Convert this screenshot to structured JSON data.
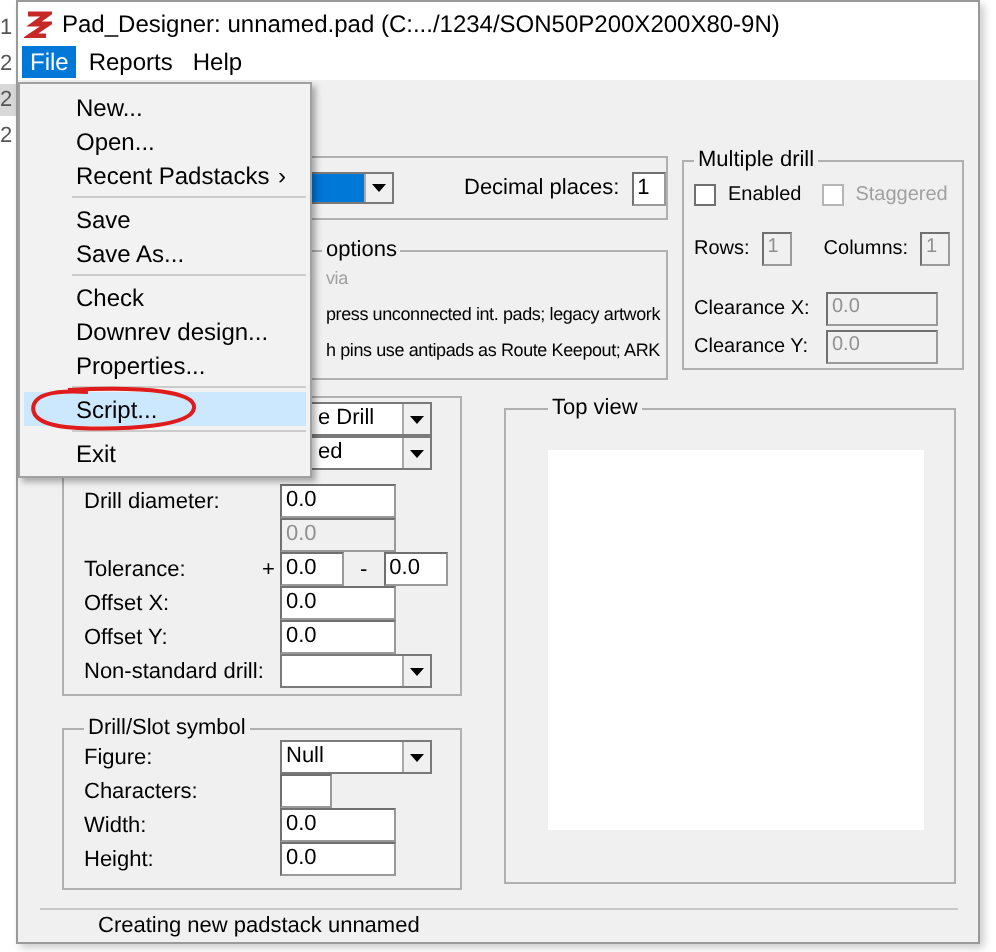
{
  "background_window": {
    "line_numbers": [
      {
        "text": "1",
        "selected": false
      },
      {
        "text": "2",
        "selected": false
      },
      {
        "text": "2",
        "selected": true
      },
      {
        "text": "2",
        "selected": false
      }
    ]
  },
  "window": {
    "title": "Pad_Designer: unnamed.pad (C:.../1234/SON50P200X200X80-9N)"
  },
  "menu_bar": [
    {
      "label": "File",
      "selected": true
    },
    {
      "label": "Reports",
      "selected": false
    },
    {
      "label": "Help",
      "selected": false
    }
  ],
  "file_menu": [
    {
      "kind": "item",
      "label": "New...",
      "selected": false
    },
    {
      "kind": "item",
      "label": "Open...",
      "selected": false
    },
    {
      "kind": "submenu",
      "label": "Recent Padstacks",
      "arrow": "›",
      "selected": false
    },
    {
      "kind": "separator"
    },
    {
      "kind": "item",
      "label": "Save",
      "selected": false
    },
    {
      "kind": "item",
      "label": "Save As...",
      "selected": false
    },
    {
      "kind": "separator"
    },
    {
      "kind": "item",
      "label": "Check",
      "selected": false
    },
    {
      "kind": "item",
      "label": "Downrev design...",
      "selected": false
    },
    {
      "kind": "item",
      "label": "Properties...",
      "selected": false
    },
    {
      "kind": "separator"
    },
    {
      "kind": "item",
      "label": "Script...",
      "selected": true,
      "circled": true
    },
    {
      "kind": "separator"
    },
    {
      "kind": "item",
      "label": "Exit",
      "selected": false
    }
  ],
  "units_group": {
    "units_dropdown": {
      "highlighted": true
    },
    "decimal_places": {
      "label": "Decimal places:",
      "value": "1"
    }
  },
  "options_group": {
    "title": "options",
    "lines": [
      {
        "text": "via",
        "disabled": true
      },
      {
        "text": "press unconnected int. pads; legacy artwork",
        "disabled": false
      },
      {
        "text": "h pins use antipads as Route Keepout; ARK",
        "disabled": false
      }
    ]
  },
  "multiple_drill": {
    "title": "Multiple drill",
    "checkboxes": [
      {
        "label": "Enabled",
        "checked": false,
        "disabled": false
      },
      {
        "label": "Staggered",
        "checked": false,
        "disabled": true
      }
    ],
    "rows": {
      "label": "Rows:",
      "value": "1",
      "disabled": true
    },
    "columns": {
      "label": "Columns:",
      "value": "1",
      "disabled": true
    },
    "clearances": [
      {
        "label": "Clearance X:",
        "value": "0.0",
        "disabled": true
      },
      {
        "label": "Clearance Y:",
        "value": "0.0",
        "disabled": true
      }
    ]
  },
  "drill_group": {
    "rows": [
      {
        "kind": "select",
        "value": "e Drill"
      },
      {
        "kind": "select",
        "value": "ed"
      },
      {
        "kind": "input",
        "label": "Drill diameter:",
        "value": "0.0",
        "disabled": false
      },
      {
        "kind": "input",
        "value": "0.0",
        "disabled": true
      },
      {
        "kind": "tolerance",
        "label": "Tolerance:",
        "plus": "+",
        "minus": "-",
        "value_plus": "0.0",
        "value_minus": "0.0"
      },
      {
        "kind": "input",
        "label": "Offset X:",
        "value": "0.0",
        "disabled": false
      },
      {
        "kind": "input",
        "label": "Offset Y:",
        "value": "0.0",
        "disabled": false
      },
      {
        "kind": "select",
        "label": "Non-standard drill:"
      }
    ]
  },
  "drill_slot_symbol": {
    "title": "Drill/Slot symbol",
    "rows": [
      {
        "kind": "select",
        "label": "Figure:",
        "value": "Null"
      },
      {
        "kind": "short_input",
        "label": "Characters:"
      },
      {
        "kind": "input",
        "label": "Width:",
        "value": "0.0",
        "disabled": false
      },
      {
        "kind": "input",
        "label": "Height:",
        "value": "0.0",
        "disabled": false
      }
    ]
  },
  "top_view": {
    "title": "Top view"
  },
  "status_bar": {
    "text": "Creating new padstack unnamed"
  }
}
